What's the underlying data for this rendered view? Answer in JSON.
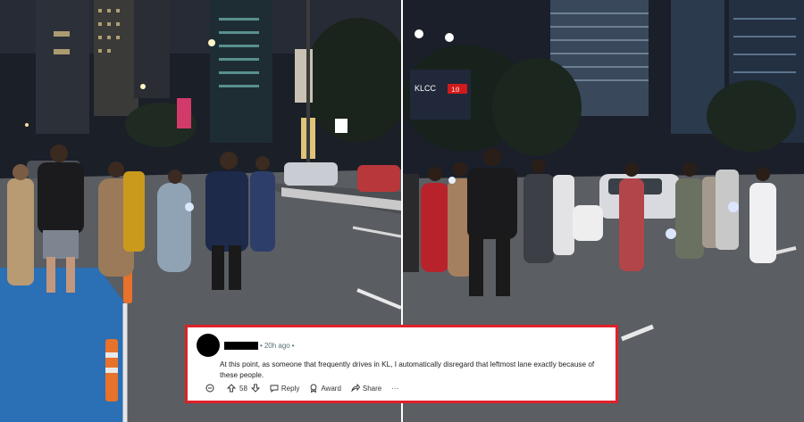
{
  "comment": {
    "time_label": "20h ago",
    "separator": "•",
    "text": "At this point, as someone that frequently drives in KL, I automatically disregard that leftmost lane exactly because of these people.",
    "vote_count": "58",
    "reply_label": "Reply",
    "award_label": "Award",
    "share_label": "Share",
    "more_label": "···"
  },
  "signs": {
    "klcc": "KLCC",
    "countdown": "10"
  },
  "colors": {
    "card_border": "#e0212b",
    "bike_lane": "#2b6fb5",
    "road": "#5a5d62",
    "night_sky": "#1a1f2a"
  },
  "icons": [
    "comment-collapse-icon",
    "upvote-icon",
    "downvote-icon",
    "reply-icon",
    "award-icon",
    "share-icon",
    "more-icon"
  ]
}
